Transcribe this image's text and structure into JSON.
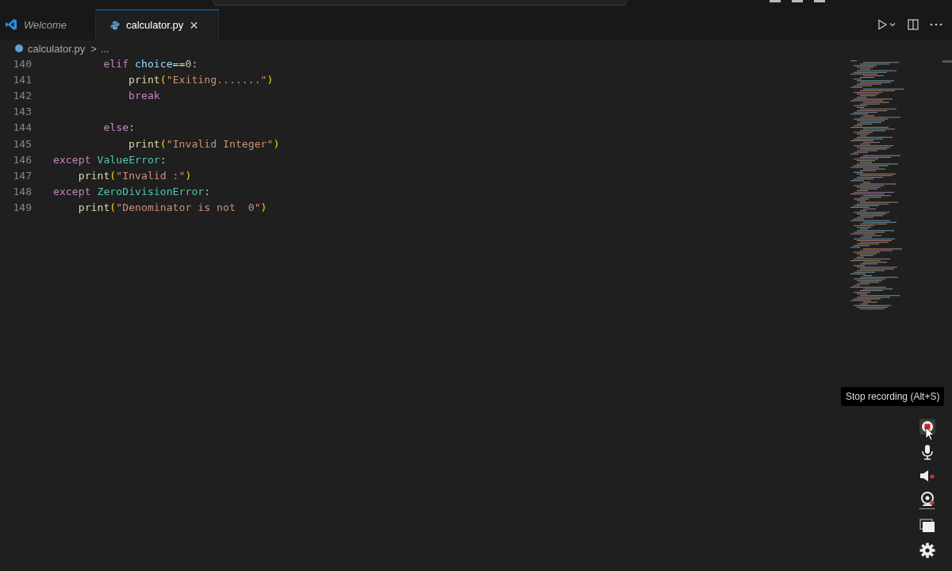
{
  "tabs": [
    {
      "label": "Welcome",
      "selected": false
    },
    {
      "label": "calculator.py",
      "selected": true
    }
  ],
  "tab_close": "×",
  "breadcrumb": {
    "file": "calculator.py",
    "separator": ">",
    "rest": "..."
  },
  "editor": {
    "lines": [
      {
        "number": "140",
        "tokens": [
          {
            "kind": "keyword",
            "text": "        elif "
          },
          {
            "kind": "variable",
            "text": "choice"
          },
          {
            "kind": "plain",
            "text": "=="
          },
          {
            "kind": "number",
            "text": "0"
          },
          {
            "kind": "plain",
            "text": ":"
          }
        ]
      },
      {
        "number": "141",
        "tokens": [
          {
            "kind": "function",
            "text": "            print"
          },
          {
            "kind": "paren",
            "text": "("
          },
          {
            "kind": "string",
            "text": "\"Exiting.......\""
          },
          {
            "kind": "paren",
            "text": ")"
          }
        ]
      },
      {
        "number": "142",
        "tokens": [
          {
            "kind": "keyword",
            "text": "            break"
          }
        ]
      },
      {
        "number": "143"
      },
      {
        "number": "144",
        "tokens": [
          {
            "kind": "keyword",
            "text": "        else"
          },
          {
            "kind": "plain",
            "text": ":"
          }
        ]
      },
      {
        "number": "145",
        "tokens": [
          {
            "kind": "function",
            "text": "            print"
          },
          {
            "kind": "paren",
            "text": "("
          },
          {
            "kind": "string",
            "text": "\"Invalid Integer\""
          },
          {
            "kind": "paren",
            "text": ")"
          }
        ]
      },
      {
        "number": "146",
        "tokens": [
          {
            "kind": "keyword",
            "text": "except "
          },
          {
            "kind": "class",
            "text": "ValueError"
          },
          {
            "kind": "plain",
            "text": ":"
          }
        ]
      },
      {
        "number": "147",
        "tokens": [
          {
            "kind": "function",
            "text": "    print"
          },
          {
            "kind": "paren",
            "text": "("
          },
          {
            "kind": "string",
            "text": "\"Invalid :\""
          },
          {
            "kind": "paren",
            "text": ")"
          }
        ]
      },
      {
        "number": "148",
        "tokens": [
          {
            "kind": "keyword",
            "text": "except "
          },
          {
            "kind": "class",
            "text": "ZeroDivisionError"
          },
          {
            "kind": "plain",
            "text": ":"
          }
        ]
      },
      {
        "number": "149",
        "tokens": [
          {
            "kind": "function",
            "text": "    print"
          },
          {
            "kind": "paren",
            "text": "("
          },
          {
            "kind": "string",
            "text": "\"Denominator is not  0\""
          },
          {
            "kind": "paren",
            "text": ")"
          }
        ]
      }
    ]
  },
  "recorder": {
    "tooltip": "Stop recording (Alt+S)",
    "tools": [
      {
        "kind": "record"
      },
      {
        "kind": "mic"
      },
      {
        "kind": "speaker"
      },
      {
        "kind": "webcam"
      },
      {
        "kind": "screen"
      },
      {
        "kind": "settings"
      }
    ]
  }
}
